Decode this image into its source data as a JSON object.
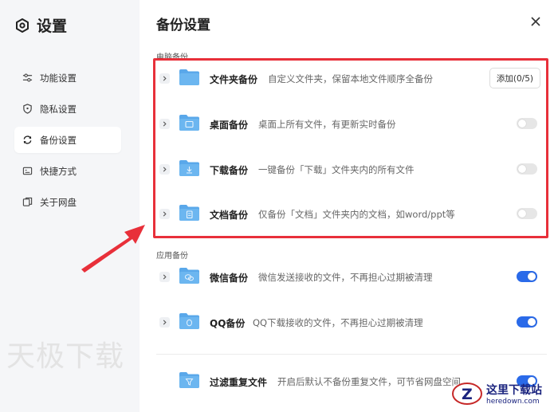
{
  "sidebar": {
    "title": "设置",
    "items": [
      {
        "label": "功能设置"
      },
      {
        "label": "隐私设置"
      },
      {
        "label": "备份设置"
      },
      {
        "label": "快捷方式"
      },
      {
        "label": "关于网盘"
      }
    ],
    "active_index": 2
  },
  "watermark": "天极下载",
  "main": {
    "title": "备份设置",
    "section_computer": "电脑备份",
    "section_apps": "应用备份",
    "rows": [
      {
        "name": "文件夹备份",
        "desc": "自定义文件夹，保留本地文件顺序全备份",
        "button": "添加(0/5)"
      },
      {
        "name": "桌面备份",
        "desc": "桌面上所有文件，有更新实时备份",
        "toggle": "off"
      },
      {
        "name": "下载备份",
        "desc": "一键备份「下载」文件夹内的所有文件",
        "toggle": "off"
      },
      {
        "name": "文档备份",
        "desc": "仅备份「文档」文件夹内的文档，如word/ppt等",
        "toggle": "off"
      },
      {
        "name": "微信备份",
        "desc": "微信发送接收的文件，不再担心过期被清理",
        "toggle": "on"
      },
      {
        "name": "QQ备份",
        "desc": "QQ下载接收的文件，不再担心过期被清理",
        "toggle": "on"
      },
      {
        "name": "过滤重复文件",
        "desc": "开启后默认不备份重复文件，可节省网盘空间",
        "toggle": "on"
      }
    ]
  },
  "badge": {
    "title": "这里下载站",
    "url": "heredown.com"
  },
  "colors": {
    "accent": "#2a6ae9",
    "highlight": "#e8303a",
    "folder": "#5aa8ea"
  }
}
